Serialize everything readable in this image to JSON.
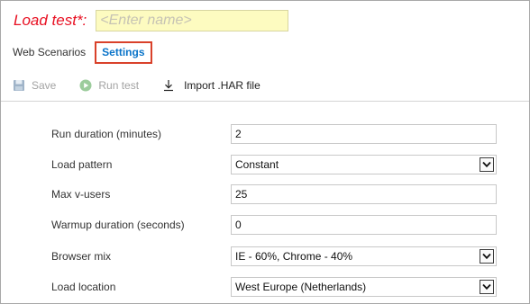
{
  "header": {
    "title_label": "Load test*:",
    "name_placeholder": "<Enter name>"
  },
  "tabs": [
    {
      "label": "Web Scenarios",
      "active": false
    },
    {
      "label": "Settings",
      "active": true
    }
  ],
  "toolbar": {
    "save_label": "Save",
    "run_label": "Run test",
    "import_label": "Import .HAR file"
  },
  "form": {
    "run_duration": {
      "label": "Run duration (minutes)",
      "value": "2"
    },
    "load_pattern": {
      "label": "Load pattern",
      "value": "Constant"
    },
    "max_vusers": {
      "label": "Max v-users",
      "value": "25"
    },
    "warmup_duration": {
      "label": "Warmup duration (seconds)",
      "value": "0"
    },
    "browser_mix": {
      "label": "Browser mix",
      "value": "IE - 60%, Chrome - 40%"
    },
    "load_location": {
      "label": "Load location",
      "value": "West Europe (Netherlands)"
    }
  },
  "colors": {
    "title_red": "#e81123",
    "input_yellow": "#fdfbc0",
    "active_tab_blue": "#0a74c9",
    "highlight_border": "#d9412a"
  },
  "icons": {
    "save": "floppy-disk-icon",
    "run": "play-circle-icon",
    "import": "download-arrow-icon",
    "dropdown": "chevron-down-icon"
  }
}
